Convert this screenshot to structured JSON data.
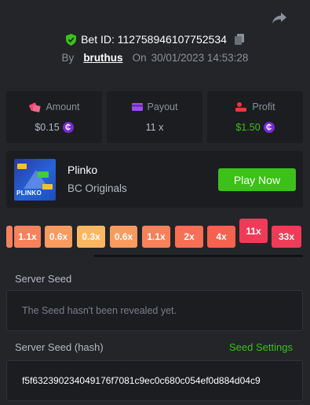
{
  "header": {
    "bet_id": "Bet ID: 112758946107752534",
    "by_label": "By",
    "username": "bruthus",
    "on_label": "On",
    "date": "30/01/2023 14:53:28"
  },
  "stats": {
    "amount": {
      "label": "Amount",
      "value": "$0.15"
    },
    "payout": {
      "label": "Payout",
      "value": "11 x"
    },
    "profit": {
      "label": "Profit",
      "value": "$1.50"
    }
  },
  "game": {
    "thumb_text": "PLINKO",
    "title": "Plinko",
    "provider": "BC Originals",
    "play_label": "Play Now"
  },
  "multipliers": {
    "items": [
      {
        "label": "",
        "color": "#f7815b"
      },
      {
        "label": "1.1x",
        "color": "#f7815b"
      },
      {
        "label": "0.6x",
        "color": "#f99a5f"
      },
      {
        "label": "0.3x",
        "color": "#fbb661"
      },
      {
        "label": "0.6x",
        "color": "#f99a5f"
      },
      {
        "label": "1.1x",
        "color": "#f7815b"
      },
      {
        "label": "2x",
        "color": "#f76f55"
      },
      {
        "label": "4x",
        "color": "#f7614f"
      },
      {
        "label": "11x",
        "color": "#ee3c58",
        "hit": true
      },
      {
        "label": "33x",
        "color": "#ee3c58"
      }
    ]
  },
  "seeds": {
    "server_seed_label": "Server Seed",
    "server_seed_text": "The Seed hasn't been revealed yet.",
    "hash_label": "Server Seed (hash)",
    "settings_label": "Seed Settings",
    "hash_value": "f5f632390234049176f7081c9ec0c680c054ef0d884d04c9"
  },
  "colors": {
    "accent_green": "#3bc117",
    "coin_purple": "#7a2ad8",
    "panel": "#1b1d21",
    "background": "#232529"
  }
}
